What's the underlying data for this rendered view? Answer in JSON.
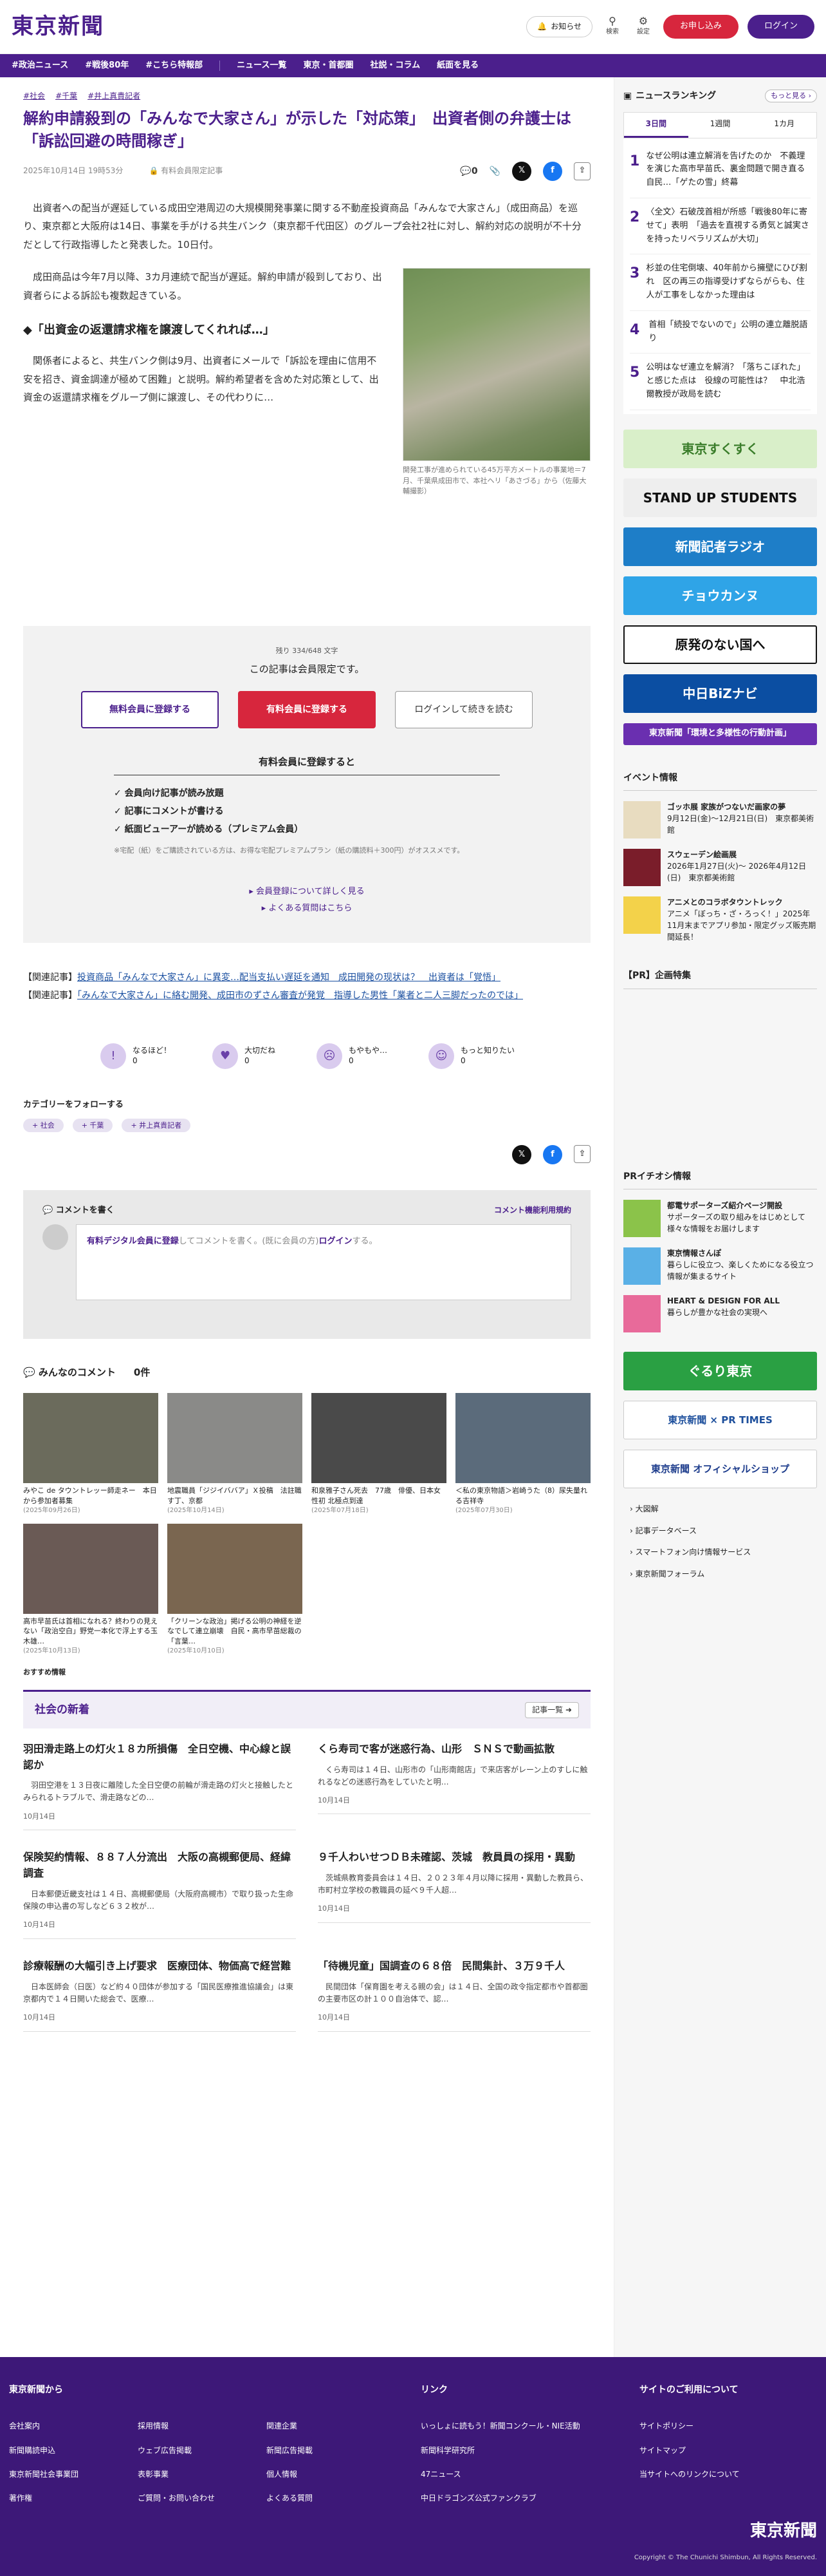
{
  "header": {
    "logo": "東京新聞",
    "notice": "お知らせ",
    "search": "検索",
    "settings": "設定",
    "apply": "お申し込み",
    "login": "ログイン"
  },
  "nav": [
    "#政治ニュース",
    "#戦後80年",
    "#こちら特報部",
    "ニュース一覧",
    "東京・首都圏",
    "社説・コラム",
    "紙面を見る"
  ],
  "article": {
    "tags": [
      "#社会",
      "#千葉",
      "#井上真貴記者"
    ],
    "title": "解約申請殺到の「みんなで大家さん」が示した「対応策」　出資者側の弁護士は「訴訟回避の時間稼ぎ」",
    "date": "2025年10月14日 19時53分",
    "member_only": "有料会員限定記事",
    "comment_count": "0",
    "p1": "　出資者への配当が遅延している成田空港周辺の大規模開発事業に関する不動産投資商品「みんなで大家さん」（成田商品）を巡り、東京都と大阪府は14日、事業を手がける共生バンク（東京都千代田区）のグループ会社2社に対し、解約対応の説明が不十分だとして行政指導したと発表した。10日付。",
    "p2": "　成田商品は今年7月以降、3カ月連続で配当が遅延。解約申請が殺到しており、出資者らによる訴訟も複数起きている。",
    "h2": "◆「出資金の返還請求権を譲渡してくれれば…」",
    "p3": "　関係者によると、共生バンク側は9月、出資者にメールで「訴訟を理由に信用不安を招き、資金調達が極めて困難」と説明。解約希望者を含めた対応策として、出資金の返還請求権をグループ側に譲渡し、その代わりに…",
    "caption": "開発工事が進められている45万平方メートルの事業地＝7月、千葉県成田市で、本社ヘリ「あさづる」から（佐藤大輔撮影）"
  },
  "paywall": {
    "remaining": "残り 334/648 文字",
    "title": "この記事は会員限定です。",
    "free": "無料会員に登録する",
    "paid": "有料会員に登録する",
    "login": "ログインして続きを読む",
    "benefits_title": "有料会員に登録すると",
    "benefits": [
      "✓ 会員向け記事が読み放題",
      "✓ 記事にコメントが書ける",
      "✓ 紙面ビューアーが読める（プレミアム会員）"
    ],
    "note": "※宅配（紙）をご購読されている方は、お得な宅配プレミアムプラン（紙の購読料＋300円）がオススメです。",
    "link1": "▸ 会員登録について詳しく見る",
    "link2": "▸ よくある質問はこちら"
  },
  "related": [
    {
      "prefix": "【関連記事】",
      "text": "投資商品「みんなで大家さん」に異変…配当支払い遅延を通知　成田開発の现状は？　出資者は「覚悟」"
    },
    {
      "prefix": "【関連記事】",
      "text": "「みんなで大家さん」に絡む開発、成田市のずさん審査が発覚　指導した男性「業者と二人三脚だったのでは」"
    }
  ],
  "reactions": [
    {
      "label": "なるほど！",
      "count": "0"
    },
    {
      "label": "大切だね",
      "count": "0"
    },
    {
      "label": "もやもや…",
      "count": "0"
    },
    {
      "label": "もっと知りたい",
      "count": "0"
    }
  ],
  "follow": {
    "title": "カテゴリーをフォローする",
    "chips": [
      "+ 社会",
      "+ 千葉",
      "+ 井上真貴記者"
    ]
  },
  "comment": {
    "title": "コメントを書く",
    "terms": "コメント機能利用規約",
    "placeholder_link": "有料デジタル会員に登録",
    "placeholder_rest": "してコメントを書く。(既に会員の方)",
    "login": "ログイン",
    "tail": "する。"
  },
  "minna": {
    "title": "みんなのコメント",
    "count": "0件"
  },
  "thumbs": [
    {
      "t": "みやこ de タウントレッー師走ネー　本日から参加者募集",
      "d": "(2025年09月26日)",
      "c": "#6b6b5c"
    },
    {
      "t": "地震職員「ジジイババア」Ｘ投稿　法註職す丁、京都",
      "d": "(2025年10月14日)",
      "c": "#8a8a88"
    },
    {
      "t": "和泉雅子さん死去　77歳　俳優、日本女性初 北極点到達",
      "d": "(2025年07月18日)",
      "c": "#4a4a4a"
    },
    {
      "t": "＜私の東京物語＞岩崎うた（8）尿失量れる吉祥寺",
      "d": "(2025年07月30日)",
      "c": "#5b6b7b"
    },
    {
      "t": "高市早苗氏は首相になれる？終わりの見えない「政治空白」野党一本化で浮上する玉木雄…",
      "d": "(2025年10月13日)",
      "c": "#6a5a55"
    },
    {
      "t": "「クリーンな政治」掲げる公明の神経を逆なでして連立崩壊　自民・高市早苗総裁の「言葉…",
      "d": "(2025年10月10日)",
      "c": "#7a6650"
    }
  ],
  "osusume": "おすすめ情報",
  "news": {
    "title": "社会の新着",
    "more": "記事一覧 ➜",
    "items": [
      {
        "h": "羽田滑走路上の灯火１８カ所損傷　全日空機、中心線と誤認か",
        "p": "　羽田空港を１３日夜に離陸した全日空便の前輪が滑走路の灯火と接触したとみられるトラブルで、滑走路などの…",
        "d": "10月14日"
      },
      {
        "h": "くら寿司で客が迷惑行為、山形　ＳＮＳで動画拡散",
        "p": "　くら寿司は１４日、山形市の「山形南館店」で来店客がレーン上のすしに触れるなどの迷惑行為をしていたと明…",
        "d": "10月14日"
      },
      {
        "h": "保険契約情報、８８７人分流出　大阪の高槻郵便局、経緯調査",
        "p": "　日本郵便近畿支社は１４日、高槻郵便局（大阪府高槻市）で取り扱った生命保険の申込書の写しなど６３２枚が…",
        "d": "10月14日"
      },
      {
        "h": "９千人わいせつＤＢ未確認、茨城　教員員の採用・異動",
        "p": "　茨城県教育委員会は１４日、２０２３年４月以降に採用・異動した教員ら、市町村立学校の教職員の延べ９千人超…",
        "d": "10月14日"
      },
      {
        "h": "診療報酬の大幅引き上げ要求　医療団体、物価高で経営難",
        "p": "　日本医師会（日医）など約４０団体が参加する「国民医療推進協議会」は東京都内で１４日開いた総会で、医療…",
        "d": "10月14日"
      },
      {
        "h": "「待機児童」国調査の６８倍　民間集計、３万９千人",
        "p": "　民間団体「保育園を考える親の会」は１４日、全国の政令指定都市や首都圏の主要市区の計１００自治体で、認…",
        "d": "10月14日"
      }
    ]
  },
  "side": {
    "ranking_title": "ニュースランキング",
    "more": "もっと見る ›",
    "tabs": [
      "3日間",
      "1週間",
      "1カ月"
    ],
    "rank": [
      "なぜ公明は連立解消を告げたのか　不義理を演じた高市早苗氏、裏金問題で開き直る自民…「ゲたの雪」終幕",
      "〈全文〉石破茂首相が所感「戦後80年に寄せて」表明　「過去を直視する勇気と誠実さを持ったリベラリズムが大切」",
      "杉並の住宅倒壊、40年前から擁壁にひび割れ　区の再三の指導受けずならがらも、住人が工事をしなかった理由は",
      "首相「続投でないので」公明の連立離脱語り",
      "公明はなぜ連立を解消？「落ちこぼれた」と感じた点は　役線の可能性は？　中北浩爾教授が政局を読む"
    ],
    "banners": [
      {
        "t": "東京すくすく",
        "bg": "#d9efc9",
        "fg": "#3a7d2a"
      },
      {
        "t": "STAND UP STUDENTS",
        "bg": "#eee",
        "fg": "#111"
      },
      {
        "t": "新聞記者ラジオ",
        "bg": "#1e7ec8",
        "fg": "#fff"
      },
      {
        "t": "チョウカンヌ",
        "bg": "#2fa4e7",
        "fg": "#fff"
      },
      {
        "t": "原発のない国へ",
        "bg": "#fff",
        "fg": "#111"
      },
      {
        "t": "中日BiZナビ",
        "bg": "#0b4ea2",
        "fg": "#fff"
      },
      {
        "t": "東京新聞「環境と多様性の行動計画」",
        "bg": "#6a2fb0",
        "fg": "#fff"
      }
    ],
    "events_title": "イベント情報",
    "events": [
      {
        "t": "ゴッホ展 家族がつないだ画家の夢",
        "s": "9月12日(金)〜12月21日(日)　東京都美術館",
        "c": "#e8dcc0"
      },
      {
        "t": "スウェーデン絵画展",
        "s": "2026年1月27日(火)〜 2026年4月12日(日)　東京都美術館",
        "c": "#7a1d2a"
      },
      {
        "t": "アニメとのコラボタウントレック",
        "s": "アニメ「ぼっち・ざ・ろっく！」2025年11月末までアプリ参加・限定グッズ販売期間延長！",
        "c": "#f3d24a"
      }
    ],
    "pr_title": "【PR】企画特集",
    "pr2_title": "PRイチオシ情報",
    "pr2": [
      {
        "t": "都電サポーターズ紹介ページ開設",
        "s": "サポーターズの取り組みをはじめとして様々な情報をお届けします",
        "c": "#8bc34a"
      },
      {
        "t": "東京情報さんぽ",
        "s": "暮らしに役立つ、楽しくためになる役立つ情報が集まるサイト",
        "c": "#5ab0e6"
      },
      {
        "t": "HEART & DESIGN FOR ALL",
        "s": "暮らしが豊かな社会の実現へ",
        "c": "#e86a9a"
      }
    ],
    "banners2": [
      {
        "t": "ぐるり東京",
        "bg": "#2aa043",
        "fg": "#fff"
      },
      {
        "t": "東京新聞 × PR TIMES",
        "bg": "#fff",
        "fg": "#1d4f9c"
      },
      {
        "t": "東京新聞 オフィシャルショップ",
        "bg": "#fff",
        "fg": "#1d3c8c"
      }
    ],
    "links": [
      "›  大図解",
      "›  記事データベース",
      "›  スマートフォン向け情報サービス",
      "›  東京新聞フォーラム"
    ]
  },
  "footer": {
    "c1": "東京新聞から",
    "c1items": [
      "会社案内",
      "採用情報",
      "関連企業",
      "新聞購読申込",
      "ウェブ広告掲載",
      "新聞広告掲載",
      "東京新聞社会事業団",
      "表彰事業",
      "個人情報",
      "著作権",
      "ご質問・お問い合わせ",
      "よくある質問"
    ],
    "c2": "リンク",
    "c2items": [
      "いっしょに読もう！新聞コンクール・NIE活動",
      "新聞科学研究所",
      "47ニュース",
      "中日ドラゴンズ公式ファンクラブ"
    ],
    "c3": "サイトのご利用について",
    "c3items": [
      "サイトポリシー",
      "サイトマップ",
      "当サイトへのリンクについて"
    ],
    "logo": "東京新聞",
    "copy": "Copyright © The Chunichi Shimbun, All Rights Reserved."
  }
}
